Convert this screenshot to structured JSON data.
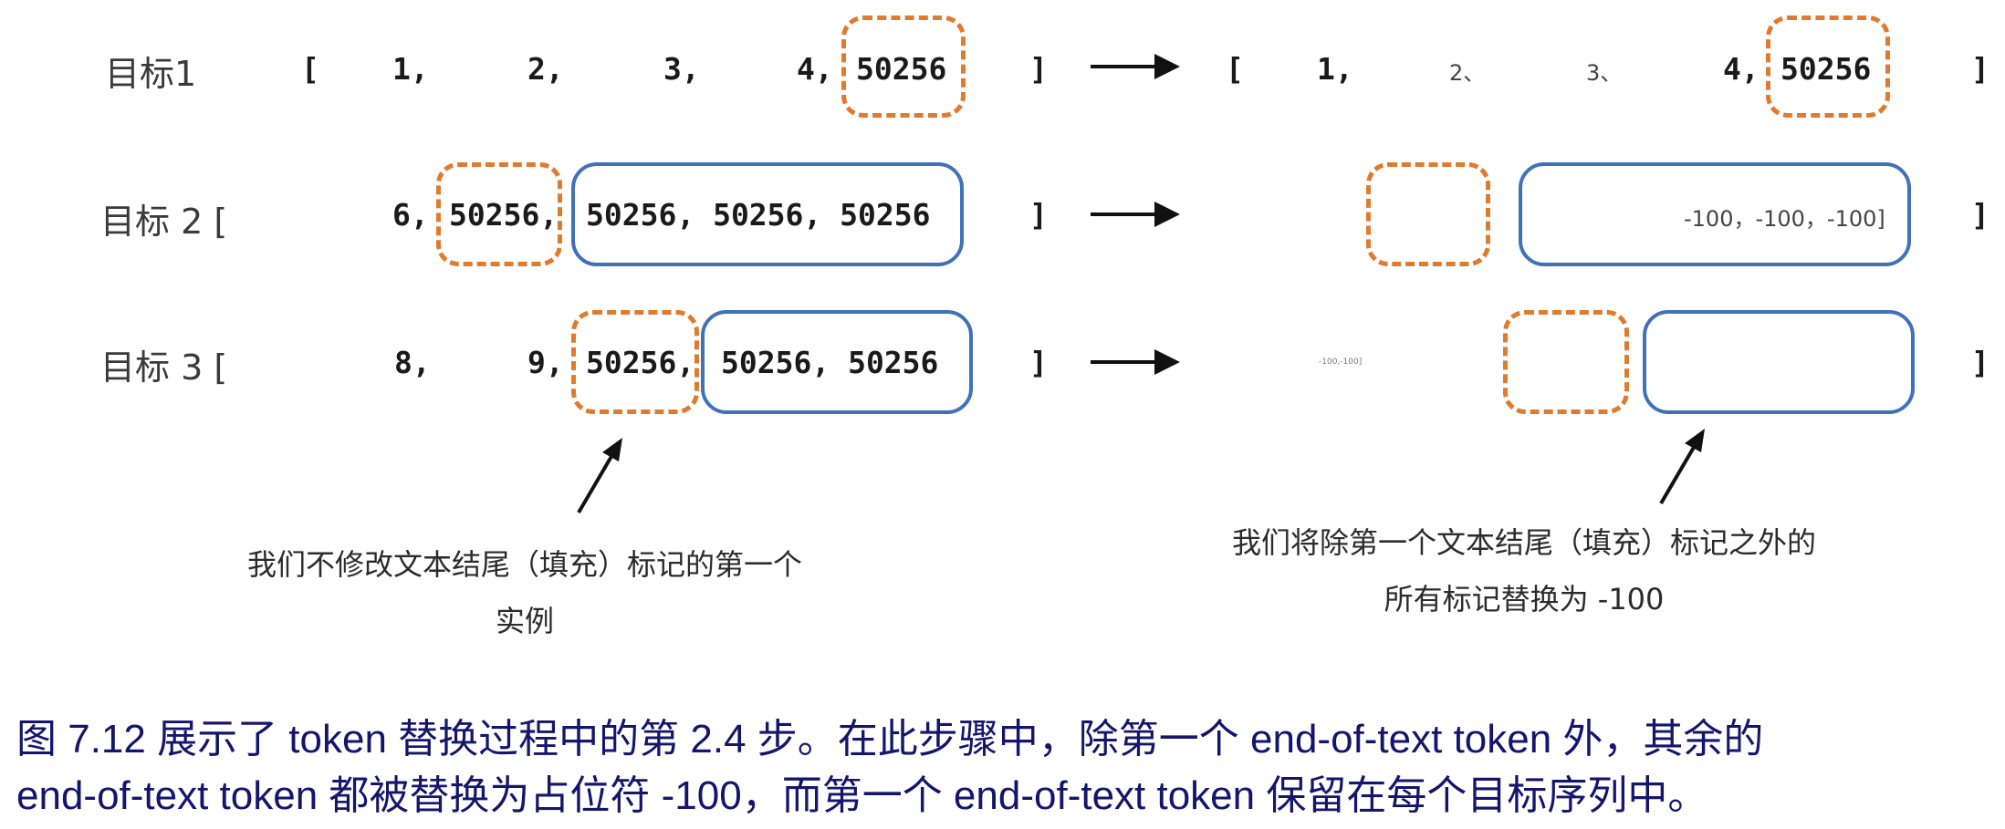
{
  "row_labels": [
    "目标1",
    "目标 2 [",
    "目标 3 ["
  ],
  "left": {
    "row1": {
      "open": "[",
      "v1": "1,",
      "v2": "2,",
      "v3": "3,",
      "v4": "4,",
      "eot": "50256",
      "close": "]"
    },
    "row2": {
      "v1": "6,",
      "eot": "50256,",
      "pad": "50256, 50256, 50256",
      "close": "]"
    },
    "row3": {
      "v1": "8,",
      "v2": "9,",
      "eot": "50256,",
      "pad": "50256, 50256",
      "close": "]"
    }
  },
  "right": {
    "row1": {
      "open": "[",
      "v1": "1,",
      "v2": "2、",
      "v3": "3、",
      "v4": "4,",
      "eot": "50256",
      "close": "]"
    },
    "row2": {
      "pad": "-100，-100，-100]",
      "close": "]"
    },
    "row3": {
      "tiny": "-100,-100]",
      "close": "]"
    }
  },
  "notes": {
    "left": [
      "我们不修改文本结尾（填充）标记的第一个",
      "实例"
    ],
    "right": [
      "我们将除第一个文本结尾（填充）标记之外的",
      "所有标记替换为 -100"
    ]
  },
  "caption": [
    "图 7.12 展示了 token 替换过程中的第 2.4 步。在此步骤中，除第一个 end-of-text token 外，其余的",
    "end-of-text token 都被替换为占位符 -100，而第一个 end-of-text token 保留在每个目标序列中。"
  ],
  "colors": {
    "eot_dashed": "#e07b2e",
    "padding_box": "#3f72b8",
    "caption_text": "#13166b"
  }
}
